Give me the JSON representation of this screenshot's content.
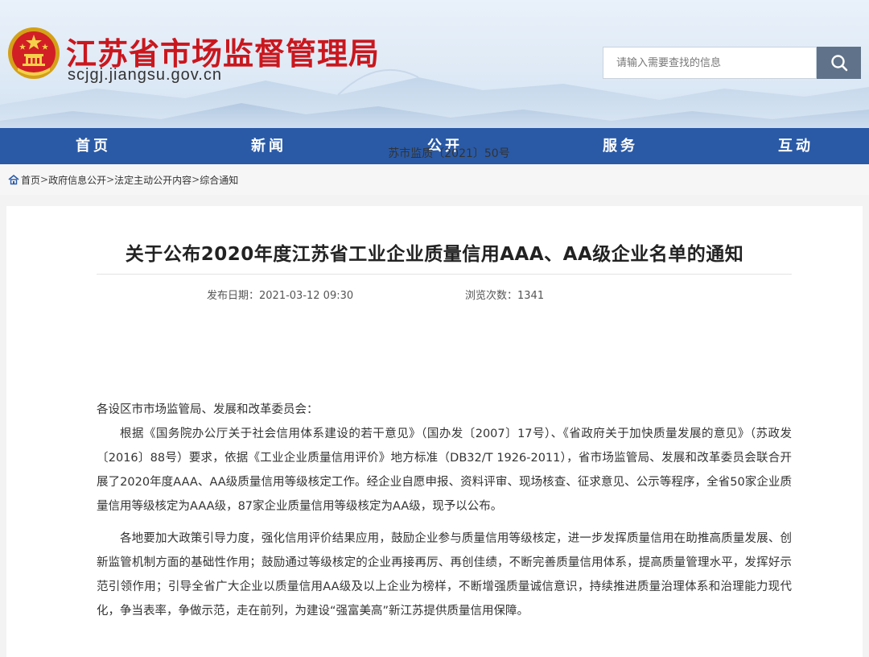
{
  "header": {
    "site_title": "江苏省市场监督管理局",
    "site_domain": "scjgj.jiangsu.gov.cn",
    "emblem_icon": "national-emblem-icon",
    "search": {
      "placeholder": "请输入需要查找的信息",
      "button_icon": "search-icon"
    }
  },
  "nav": {
    "items": [
      {
        "label": "首页"
      },
      {
        "label": "新闻"
      },
      {
        "label": "公开"
      },
      {
        "label": "服务"
      },
      {
        "label": "互动"
      }
    ]
  },
  "breadcrumb": {
    "home_icon": "home-icon",
    "items": [
      "首页",
      "政府信息公开",
      "法定主动公开内容",
      "综合通知"
    ],
    "separator": ">"
  },
  "article": {
    "title": "关于公布2020年度江苏省工业企业质量信用AAA、AA级企业名单的通知",
    "publish_date": "发布日期：2021-03-12 09:30",
    "view_count": "浏览次数：1341",
    "doc_number": "苏市监质〔2021〕50号",
    "salutation": "各设区市市场监管局、发展和改革委员会：",
    "paragraphs": [
      "根据《国务院办公厅关于社会信用体系建设的若干意见》（国办发〔2007〕17号）、《省政府关于加快质量发展的意见》（苏政发〔2016〕88号）要求，依据《工业企业质量信用评价》地方标准（DB32/T 1926-2011），省市场监管局、发展和改革委员会联合开展了2020年度AAA、AA级质量信用等级核定工作。经企业自愿申报、资料评审、现场核查、征求意见、公示等程序，全省50家企业质量信用等级核定为AAA级，87家企业质量信用等级核定为AA级，现予以公布。",
      "各地要加大政策引导力度，强化信用评价结果应用，鼓励企业参与质量信用等级核定，进一步发挥质量信用在助推高质量发展、创新监管机制方面的基础性作用；鼓励通过等级核定的企业再接再厉、再创佳绩，不断完善质量信用体系，提高质量管理水平，发挥好示范引领作用；引导全省广大企业以质量信用AA级及以上企业为榜样，不断增强质量诚信意识，持续推进质量治理体系和治理能力现代化，争当表率，争做示范，走在前列，为建设“强富美高”新江苏提供质量信用保障。"
    ]
  },
  "colors": {
    "title_red": "#c9171e",
    "nav_blue": "#2a5aa6",
    "search_button": "#5f7289"
  }
}
